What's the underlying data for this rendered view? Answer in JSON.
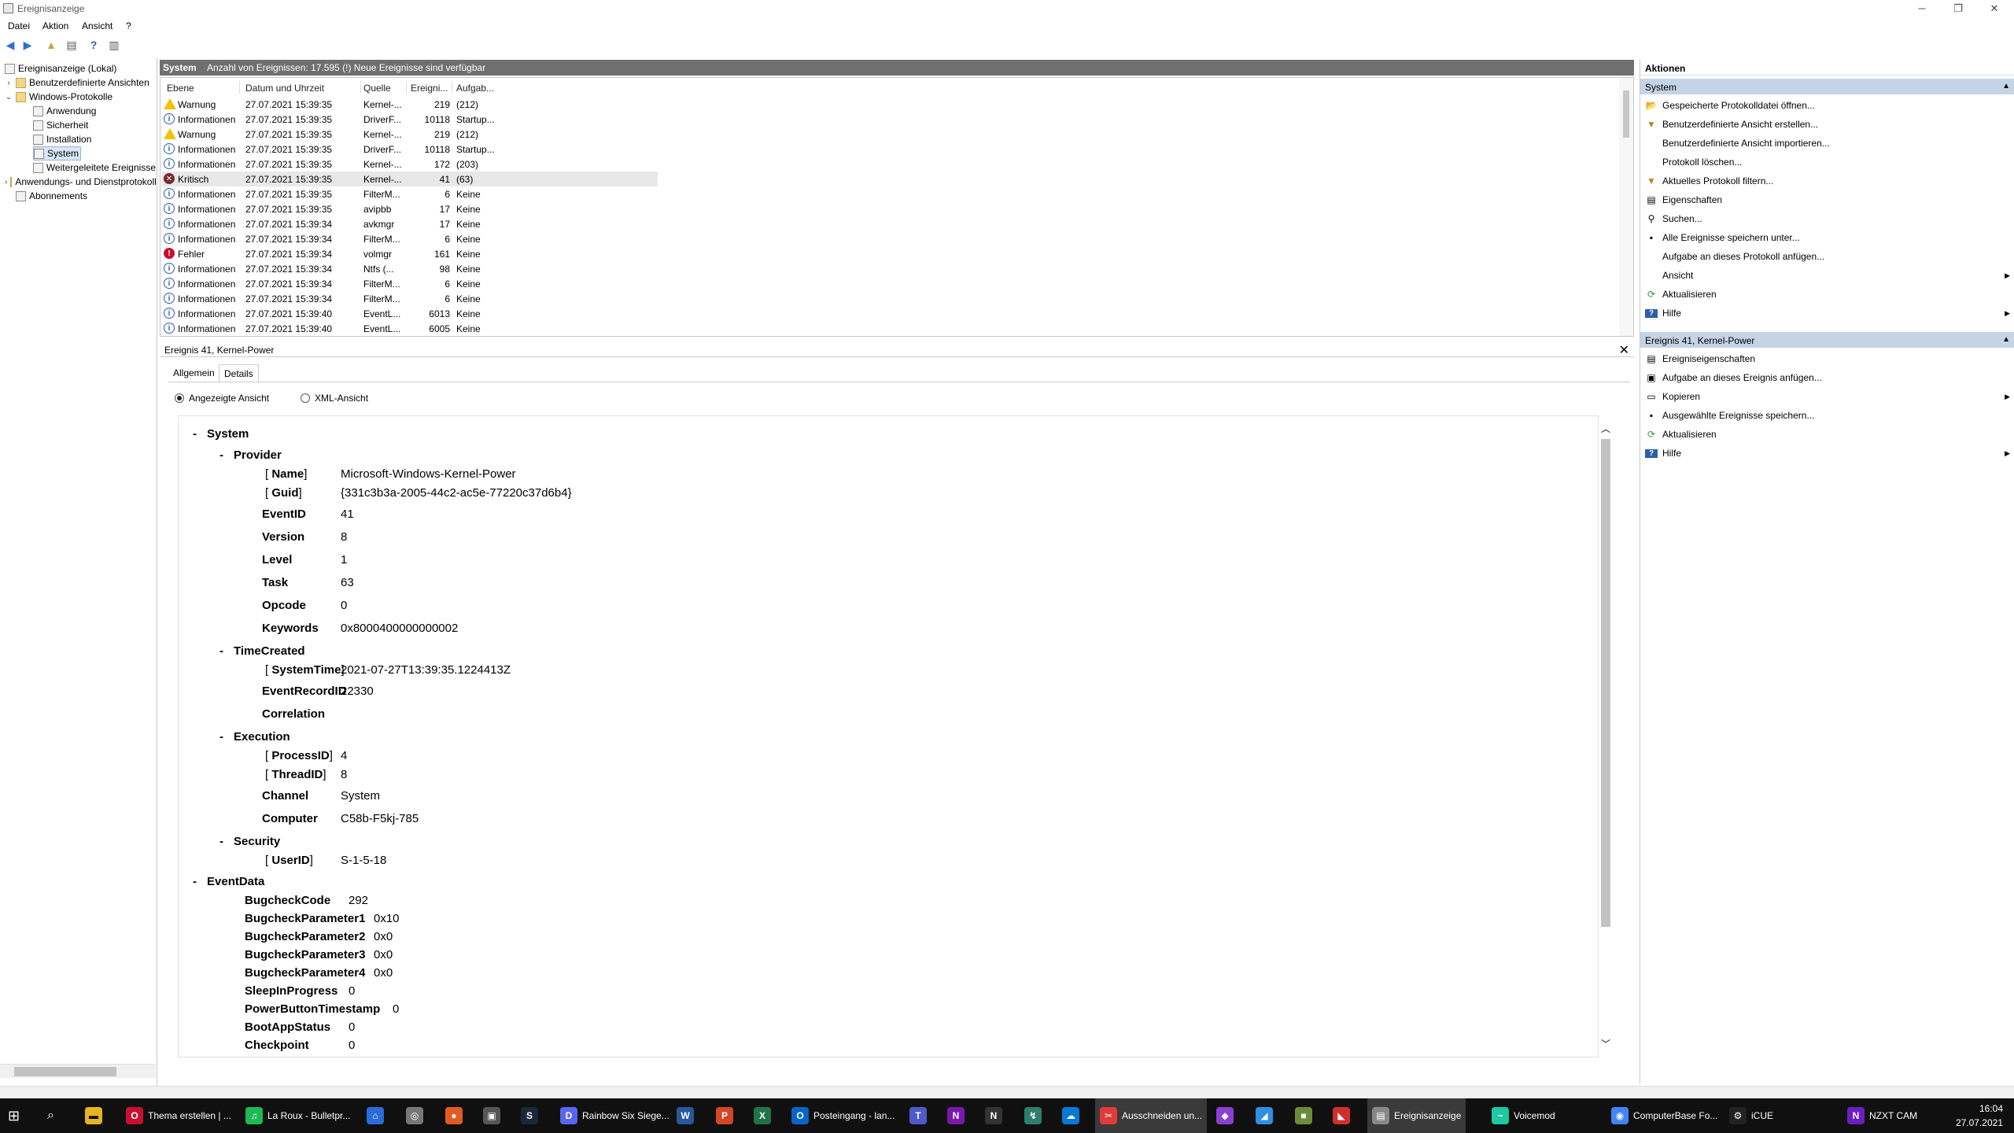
{
  "window": {
    "title": "Ereignisanzeige"
  },
  "menu": [
    "Datei",
    "Aktion",
    "Ansicht",
    "?"
  ],
  "tree": {
    "root": "Ereignisanzeige (Lokal)",
    "custom": "Benutzerdefinierte Ansichten",
    "winlogs": "Windows-Protokolle",
    "children": [
      "Anwendung",
      "Sicherheit",
      "Installation",
      "System",
      "Weitergeleitete Ereignisse"
    ],
    "appsvc": "Anwendungs- und Dienstprotokolle",
    "subs": "Abonnements"
  },
  "header": {
    "name": "System",
    "info": "Anzahl von Ereignissen: 17.595 (!) Neue Ereignisse sind verfügbar"
  },
  "columns": [
    "Ebene",
    "Datum und Uhrzeit",
    "Quelle",
    "Ereigni...",
    "Aufgab..."
  ],
  "events": [
    {
      "sev": "warn",
      "level": "Warnung",
      "date": "27.07.2021 15:39:35",
      "source": "Kernel-...",
      "id": "219",
      "task": "(212)"
    },
    {
      "sev": "info",
      "level": "Informationen",
      "date": "27.07.2021 15:39:35",
      "source": "DriverF...",
      "id": "10118",
      "task": "Startup..."
    },
    {
      "sev": "warn",
      "level": "Warnung",
      "date": "27.07.2021 15:39:35",
      "source": "Kernel-...",
      "id": "219",
      "task": "(212)"
    },
    {
      "sev": "info",
      "level": "Informationen",
      "date": "27.07.2021 15:39:35",
      "source": "DriverF...",
      "id": "10118",
      "task": "Startup..."
    },
    {
      "sev": "info",
      "level": "Informationen",
      "date": "27.07.2021 15:39:35",
      "source": "Kernel-...",
      "id": "172",
      "task": "(203)"
    },
    {
      "sev": "crit",
      "level": "Kritisch",
      "date": "27.07.2021 15:39:35",
      "source": "Kernel-...",
      "id": "41",
      "task": "(63)"
    },
    {
      "sev": "info",
      "level": "Informationen",
      "date": "27.07.2021 15:39:35",
      "source": "FilterM...",
      "id": "6",
      "task": "Keine"
    },
    {
      "sev": "info",
      "level": "Informationen",
      "date": "27.07.2021 15:39:35",
      "source": "avipbb",
      "id": "17",
      "task": "Keine"
    },
    {
      "sev": "info",
      "level": "Informationen",
      "date": "27.07.2021 15:39:34",
      "source": "avkmgr",
      "id": "17",
      "task": "Keine"
    },
    {
      "sev": "info",
      "level": "Informationen",
      "date": "27.07.2021 15:39:34",
      "source": "FilterM...",
      "id": "6",
      "task": "Keine"
    },
    {
      "sev": "err",
      "level": "Fehler",
      "date": "27.07.2021 15:39:34",
      "source": "volmgr",
      "id": "161",
      "task": "Keine"
    },
    {
      "sev": "info",
      "level": "Informationen",
      "date": "27.07.2021 15:39:34",
      "source": "Ntfs (...",
      "id": "98",
      "task": "Keine"
    },
    {
      "sev": "info",
      "level": "Informationen",
      "date": "27.07.2021 15:39:34",
      "source": "FilterM...",
      "id": "6",
      "task": "Keine"
    },
    {
      "sev": "info",
      "level": "Informationen",
      "date": "27.07.2021 15:39:34",
      "source": "FilterM...",
      "id": "6",
      "task": "Keine"
    },
    {
      "sev": "info",
      "level": "Informationen",
      "date": "27.07.2021 15:39:40",
      "source": "EventL...",
      "id": "6013",
      "task": "Keine"
    },
    {
      "sev": "info",
      "level": "Informationen",
      "date": "27.07.2021 15:39:40",
      "source": "EventL...",
      "id": "6005",
      "task": "Keine"
    }
  ],
  "detail": {
    "title": "Ereignis 41, Kernel-Power",
    "tabs": [
      "Allgemein",
      "Details"
    ],
    "radio_friendly": "Angezeigte Ansicht",
    "radio_xml": "XML-Ansicht",
    "lines": [
      {
        "k": "System",
        "v": "",
        "t": "sec",
        "coll": "-"
      },
      {
        "k": "Provider",
        "v": "",
        "t": "sec",
        "coll": "-"
      },
      {
        "k": "Name",
        "v": "Microsoft-Windows-Kernel-Power",
        "t": "attr"
      },
      {
        "k": "Guid",
        "v": "{331c3b3a-2005-44c2-ac5e-77220c37d6b4}",
        "t": "attr"
      },
      {
        "k": "EventID",
        "v": "41",
        "t": "kv"
      },
      {
        "k": "Version",
        "v": "8",
        "t": "kv"
      },
      {
        "k": "Level",
        "v": "1",
        "t": "kv"
      },
      {
        "k": "Task",
        "v": "63",
        "t": "kv"
      },
      {
        "k": "Opcode",
        "v": "0",
        "t": "kv"
      },
      {
        "k": "Keywords",
        "v": "0x8000400000000002",
        "t": "kv"
      },
      {
        "k": "TimeCreated",
        "v": "",
        "t": "sec",
        "coll": "-"
      },
      {
        "k": "SystemTime",
        "v": "2021-07-27T13:39:35.1224413Z",
        "t": "attr"
      },
      {
        "k": "EventRecordID",
        "v": "22330",
        "t": "kv"
      },
      {
        "k": "Correlation",
        "v": "",
        "t": "kv"
      },
      {
        "k": "Execution",
        "v": "",
        "t": "sec",
        "coll": "-"
      },
      {
        "k": "ProcessID",
        "v": "4",
        "t": "attr"
      },
      {
        "k": "ThreadID",
        "v": "8",
        "t": "attr"
      },
      {
        "k": "Channel",
        "v": "System",
        "t": "kv"
      },
      {
        "k": "Computer",
        "v": "C58b-F5kj-785",
        "t": "kv"
      },
      {
        "k": "Security",
        "v": "",
        "t": "sec",
        "coll": "-"
      },
      {
        "k": "UserID",
        "v": "S-1-5-18",
        "t": "attr"
      },
      {
        "k": "EventData",
        "v": "",
        "t": "sec",
        "coll": "-"
      },
      {
        "k": "BugcheckCode",
        "v": "292",
        "t": "ed"
      },
      {
        "k": "BugcheckParameter1",
        "v": "0x10",
        "t": "ed"
      },
      {
        "k": "BugcheckParameter2",
        "v": "0x0",
        "t": "ed"
      },
      {
        "k": "BugcheckParameter3",
        "v": "0x0",
        "t": "ed"
      },
      {
        "k": "BugcheckParameter4",
        "v": "0x0",
        "t": "ed"
      },
      {
        "k": "SleepInProgress",
        "v": "0",
        "t": "ed"
      },
      {
        "k": "PowerButtonTimestamp",
        "v": "0",
        "t": "ed"
      },
      {
        "k": "BootAppStatus",
        "v": "0",
        "t": "ed"
      },
      {
        "k": "Checkpoint",
        "v": "0",
        "t": "ed"
      }
    ]
  },
  "actions": {
    "title": "Aktionen",
    "sec1": "System",
    "sec1_items": [
      {
        "label": "Gespeicherte Protokolldatei öffnen...",
        "icon": "open-folder-icon",
        "sub": ""
      },
      {
        "label": "Benutzerdefinierte Ansicht erstellen...",
        "icon": "filter-icon",
        "sub": ""
      },
      {
        "label": "Benutzerdefinierte Ansicht importieren...",
        "icon": "",
        "sub": ""
      },
      {
        "label": "Protokoll löschen...",
        "icon": "",
        "sub": ""
      },
      {
        "label": "Aktuelles Protokoll filtern...",
        "icon": "filter-icon",
        "sub": ""
      },
      {
        "label": "Eigenschaften",
        "icon": "properties-icon",
        "sub": ""
      },
      {
        "label": "Suchen...",
        "icon": "binoculars-icon",
        "sub": ""
      },
      {
        "label": "Alle Ereignisse speichern unter...",
        "icon": "save-icon",
        "sub": ""
      },
      {
        "label": "Aufgabe an dieses Protokoll anfügen...",
        "icon": "",
        "sub": ""
      },
      {
        "label": "Ansicht",
        "icon": "",
        "sub": "▶"
      },
      {
        "label": "Aktualisieren",
        "icon": "refresh-icon",
        "sub": ""
      },
      {
        "label": "Hilfe",
        "icon": "help-icon",
        "sub": "▶"
      }
    ],
    "sec2": "Ereignis 41, Kernel-Power",
    "sec2_items": [
      {
        "label": "Ereigniseigenschaften",
        "icon": "properties-icon",
        "sub": ""
      },
      {
        "label": "Aufgabe an dieses Ereignis anfügen...",
        "icon": "task-icon",
        "sub": ""
      },
      {
        "label": "Kopieren",
        "icon": "copy-icon",
        "sub": "▶"
      },
      {
        "label": "Ausgewählte Ereignisse speichern...",
        "icon": "save-icon",
        "sub": ""
      },
      {
        "label": "Aktualisieren",
        "icon": "refresh-icon",
        "sub": ""
      },
      {
        "label": "Hilfe",
        "icon": "help-icon",
        "sub": "▶"
      }
    ]
  },
  "taskbar": {
    "items": [
      {
        "label": "Thema erstellen | ...",
        "color": "#c8102e",
        "glyph": "O"
      },
      {
        "label": "La Roux - Bulletpr...",
        "color": "#1db954",
        "glyph": "♫"
      },
      {
        "label": "",
        "color": "#2b6cd6",
        "glyph": "⌂"
      },
      {
        "label": "",
        "color": "#777777",
        "glyph": "◎"
      },
      {
        "label": "",
        "color": "#e25c22",
        "glyph": "●"
      },
      {
        "label": "",
        "color": "#555555",
        "glyph": "▣"
      },
      {
        "label": "",
        "color": "#1b2838",
        "glyph": "S"
      },
      {
        "label": "Rainbow Six Siege...",
        "color": "#5865f2",
        "glyph": "D"
      },
      {
        "label": "",
        "color": "#2b579a",
        "glyph": "W"
      },
      {
        "label": "",
        "color": "#d24726",
        "glyph": "P"
      },
      {
        "label": "",
        "color": "#217346",
        "glyph": "X"
      },
      {
        "label": "Posteingang - lan...",
        "color": "#0a64c8",
        "glyph": "O"
      },
      {
        "label": "",
        "color": "#5059c9",
        "glyph": "T"
      },
      {
        "label": "",
        "color": "#7719aa",
        "glyph": "N"
      },
      {
        "label": "",
        "color": "#333333",
        "glyph": "N"
      },
      {
        "label": "",
        "color": "#2f7d6d",
        "glyph": "↯"
      },
      {
        "label": "",
        "color": "#0a78d4",
        "glyph": "☁"
      },
      {
        "label": "Ausschneiden un...",
        "color": "#e03a3a",
        "glyph": "✂"
      },
      {
        "label": "",
        "color": "#8a3fd1",
        "glyph": "◆"
      },
      {
        "label": "",
        "color": "#2f8fe0",
        "glyph": "◢"
      },
      {
        "label": "",
        "color": "#6d8c3a",
        "glyph": "■"
      },
      {
        "label": "",
        "color": "#d12f2f",
        "glyph": "◣"
      },
      {
        "label": "Ereignisanzeige",
        "color": "#888888",
        "glyph": "▤"
      },
      {
        "label": "Voicemod",
        "color": "#1ec8a0",
        "glyph": "~"
      },
      {
        "label": "ComputerBase Fo...",
        "color": "#4285f4",
        "glyph": "◉"
      },
      {
        "label": "iCUE",
        "color": "#222222",
        "glyph": "⚙"
      },
      {
        "label": "NZXT CAM",
        "color": "#6b1fbf",
        "glyph": "N"
      }
    ],
    "time": "16:04",
    "date": "27.07.2021"
  }
}
